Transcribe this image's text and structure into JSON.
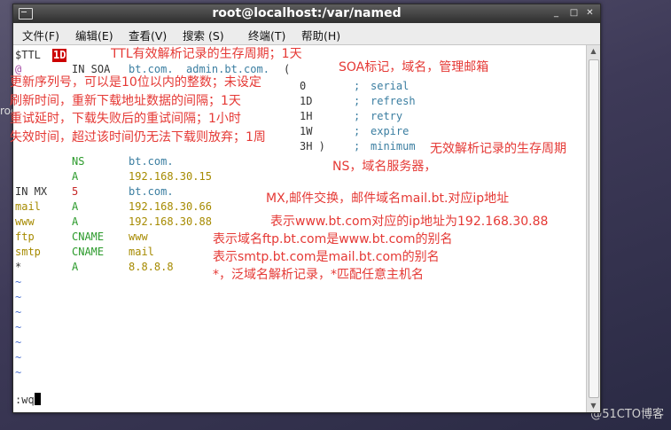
{
  "desktop": {
    "side_text": "roc",
    "watermark": "@51CTO博客"
  },
  "window": {
    "title": "root@localhost:/var/named",
    "menu": [
      "文件(F)",
      "编辑(E)",
      "查看(V)",
      "搜索 (S)",
      "终端(T)",
      "帮助(H)"
    ],
    "controls": {
      "minimize": "_",
      "maximize": "□",
      "close": "✕"
    }
  },
  "zone": {
    "ttl_label": "$TTL",
    "ttl_value": "1D",
    "soa": {
      "at": "@",
      "class_type": "IN SOA",
      "ns": "bt.com.",
      "mail": "admin.bt.com.",
      "paren": "("
    },
    "soa_fields": [
      {
        "value": "0",
        "semi": ";",
        "name": "serial"
      },
      {
        "value": "1D",
        "semi": ";",
        "name": "refresh"
      },
      {
        "value": "1H",
        "semi": ";",
        "name": "retry"
      },
      {
        "value": "1W",
        "semi": ";",
        "name": "expire"
      },
      {
        "value": "3H )",
        "semi": ";",
        "name": "minimum"
      }
    ],
    "records": [
      {
        "name": "",
        "type": "NS",
        "data": "bt.com."
      },
      {
        "name": "",
        "type": "A",
        "data": "192.168.30.15"
      },
      {
        "name": "IN MX",
        "type": "5",
        "data": "bt.com."
      },
      {
        "name": "mail",
        "type": "A",
        "data": "192.168.30.66"
      },
      {
        "name": "www",
        "type": "A",
        "data": "192.168.30.88"
      },
      {
        "name": "ftp",
        "type": "CNAME",
        "data": "www"
      },
      {
        "name": "smtp",
        "type": "CNAME",
        "data": "mail"
      },
      {
        "name": "*",
        "type": "A",
        "data": "8.8.8.8"
      }
    ],
    "tilde": "~",
    "command": ":wq"
  },
  "annotations": {
    "ttl": "TTL有效解析记录的生存周期；1天",
    "soa": "SOA标记，域名，管理邮箱",
    "serial": "更新序列号，可以是10位以内的整数；未设定",
    "refresh": "刷新时间，重新下载地址数据的间隔；1天",
    "retry": "重试延时，下载失败后的重试间隔；1小时",
    "expire": "失效时间，超过该时间仍无法下载则放弃；1周",
    "minimum": "无效解析记录的生存周期",
    "ns": "NS，域名服务器，",
    "mx": "MX,邮件交换，邮件域名mail.bt.对应ip地址",
    "www": "表示www.bt.com对应的ip地址为192.168.30.88",
    "ftp": "表示域名ftp.bt.com是www.bt.com的别名",
    "smtp": "表示smtp.bt.com是mail.bt.com的别名",
    "wildcard": "*，泛域名解析记录，*匹配任意主机名"
  }
}
